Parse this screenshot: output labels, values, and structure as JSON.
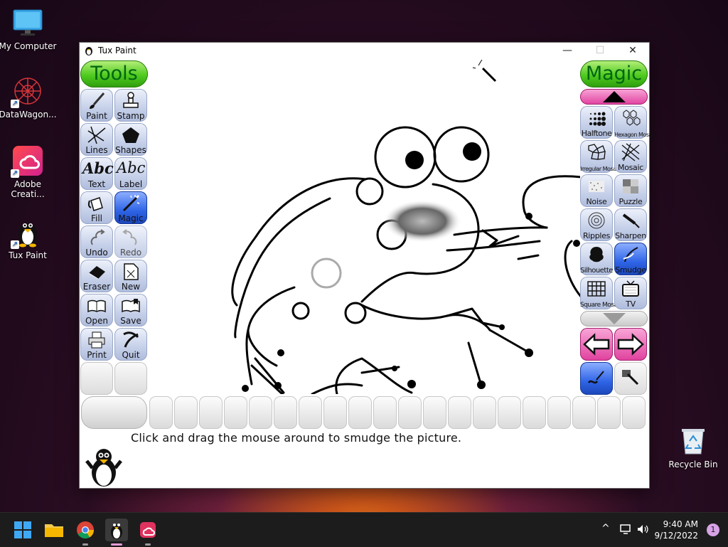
{
  "desktop": {
    "icons": [
      {
        "label": "My Computer"
      },
      {
        "label": "DataWagon..."
      },
      {
        "label": "Adobe Creati..."
      },
      {
        "label": "Tux Paint"
      },
      {
        "label": "Recycle Bin"
      }
    ]
  },
  "window": {
    "title": "Tux Paint",
    "minimize": "—",
    "maximize": "☐",
    "close": "✕"
  },
  "tools": {
    "header": "Tools",
    "selected": "Magic",
    "items": [
      {
        "label": "Paint",
        "icon": "paintbrush-icon"
      },
      {
        "label": "Stamp",
        "icon": "stamp-icon"
      },
      {
        "label": "Lines",
        "icon": "lines-icon"
      },
      {
        "label": "Shapes",
        "icon": "pentagon-icon"
      },
      {
        "label": "Text",
        "icon": "text-abc-icon"
      },
      {
        "label": "Label",
        "icon": "label-abc-icon"
      },
      {
        "label": "Fill",
        "icon": "paint-bucket-icon"
      },
      {
        "label": "Magic",
        "icon": "magic-wand-icon"
      },
      {
        "label": "Undo",
        "icon": "undo-icon"
      },
      {
        "label": "Redo",
        "icon": "redo-icon"
      },
      {
        "label": "Eraser",
        "icon": "eraser-icon"
      },
      {
        "label": "New",
        "icon": "new-page-icon"
      },
      {
        "label": "Open",
        "icon": "open-book-icon"
      },
      {
        "label": "Save",
        "icon": "save-book-icon"
      },
      {
        "label": "Print",
        "icon": "printer-icon"
      },
      {
        "label": "Quit",
        "icon": "quit-x-icon"
      }
    ]
  },
  "magic": {
    "header": "Magic",
    "selected": "Smudge",
    "items": [
      {
        "label": "Halftone",
        "icon": "halftone-icon"
      },
      {
        "label": "Hexagon Mosaic",
        "icon": "hexagon-mosaic-icon"
      },
      {
        "label": "Irregular Mosaic",
        "icon": "irregular-mosaic-icon"
      },
      {
        "label": "Mosaic",
        "icon": "mosaic-icon"
      },
      {
        "label": "Noise",
        "icon": "noise-icon"
      },
      {
        "label": "Puzzle",
        "icon": "puzzle-icon"
      },
      {
        "label": "Ripples",
        "icon": "ripples-icon"
      },
      {
        "label": "Sharpen",
        "icon": "sharpen-icon"
      },
      {
        "label": "Silhouette",
        "icon": "silhouette-icon"
      },
      {
        "label": "Smudge",
        "icon": "smudge-icon"
      },
      {
        "label": "Square Mosaic",
        "icon": "square-mosaic-icon"
      },
      {
        "label": "TV",
        "icon": "tv-icon"
      }
    ]
  },
  "status": {
    "message": "Click and drag the mouse around to smudge the picture."
  },
  "taskbar": {
    "time": "9:40 AM",
    "date": "9/12/2022",
    "notifications": "1",
    "tray_chevron": "^"
  },
  "colors": {
    "tools_header": "#4fcb1f",
    "selected_tool": "#2e64e6",
    "scroll_pill": "#e0419e"
  }
}
